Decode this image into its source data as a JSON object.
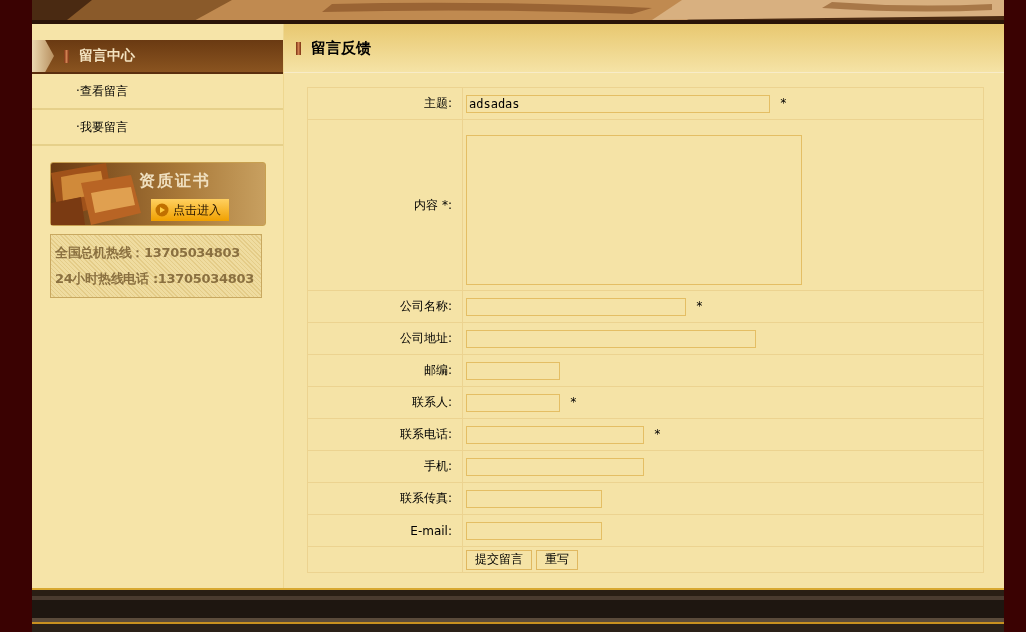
{
  "sidebar": {
    "title": "留言中心",
    "items": [
      {
        "label": "·查看留言",
        "selected": false
      },
      {
        "label": "·我要留言",
        "selected": false
      }
    ],
    "certificate": {
      "title": "资质证书",
      "button": "点击进入"
    },
    "hotlines": [
      "全国总机热线：13705034803",
      "24小时热线电话 :13705034803"
    ]
  },
  "main": {
    "title": "留言反馈",
    "rows": [
      {
        "kind": "text",
        "label": "主题:",
        "value": "adsadas",
        "mark": "*"
      },
      {
        "kind": "textarea",
        "label": "内容 *:"
      },
      {
        "kind": "text",
        "label": "公司名称:",
        "mark": "*"
      },
      {
        "kind": "text",
        "label": "公司地址:"
      },
      {
        "kind": "text",
        "label": "邮编:"
      },
      {
        "kind": "text",
        "label": "联系人:",
        "mark": "*"
      },
      {
        "kind": "text",
        "label": "联系电话:",
        "mark": "*"
      },
      {
        "kind": "text",
        "label": "手机:"
      },
      {
        "kind": "text",
        "label": "联系传真:"
      },
      {
        "kind": "text",
        "label": "E-mail:"
      },
      {
        "kind": "buttons",
        "buttons": [
          "提交留言",
          "重写"
        ]
      }
    ]
  }
}
